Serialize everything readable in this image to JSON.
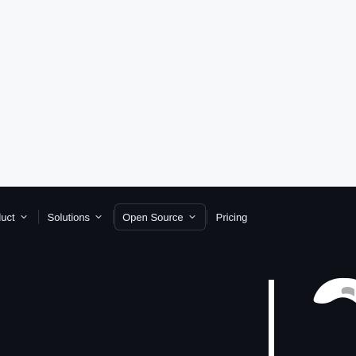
{
  "page": {
    "background_color": "#0d1117",
    "top_area_color": "#f6f8fa"
  },
  "navigation": {
    "items": [
      {
        "label": "duct",
        "icon": "chevron-down-icon",
        "selected": false
      },
      {
        "label": "Solutions",
        "icon": "chevron-down-icon",
        "selected": false
      },
      {
        "label": "Open Source",
        "icon": "chevron-down-icon",
        "selected": true
      },
      {
        "label": "Pricing",
        "icon": "",
        "selected": false
      }
    ]
  },
  "decor": {
    "primary_color": "#ffffff",
    "secondary_color": "#c9d1d9"
  }
}
